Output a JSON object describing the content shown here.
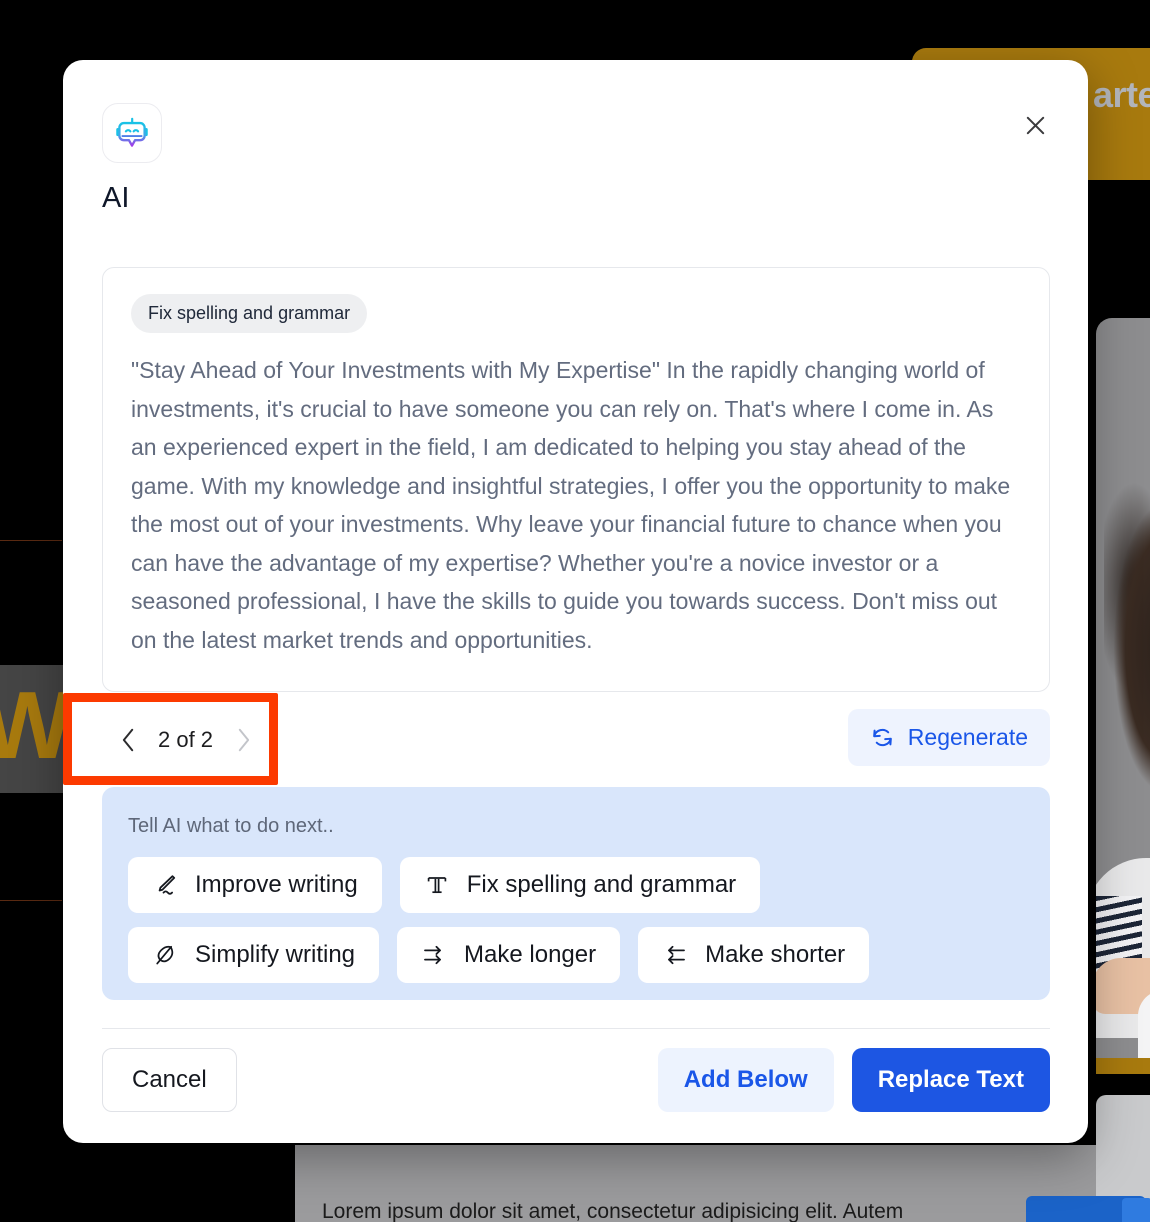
{
  "background": {
    "gold_panel_text": "arted",
    "tile_letter": "W",
    "bottom_paragraph": "Lorem ipsum dolor sit amet, consectetur adipisicing elit. Autem"
  },
  "modal": {
    "icon_name": "ai-robot-icon",
    "title": "AI",
    "close_label": "Close",
    "result": {
      "chip_label": "Fix spelling and grammar",
      "body": "\"Stay Ahead of Your Investments with My Expertise\" In the rapidly changing world of investments, it's crucial to have someone you can rely on. That's where I come in. As an experienced expert in the field, I am dedicated to helping you stay ahead of the game. With my knowledge and insightful strategies, I offer you the opportunity to make the most out of your investments. Why leave your financial future to chance when you can have the advantage of my expertise? Whether you're a novice investor or a seasoned professional, I have the skills to guide you towards success. Don't miss out on the latest market trends and opportunities."
    },
    "pager": {
      "prev_icon": "chevron-left-icon",
      "next_icon": "chevron-right-icon",
      "label": "2 of 2",
      "current": 2,
      "total": 2
    },
    "regenerate": {
      "icon": "refresh-icon",
      "label": "Regenerate"
    },
    "suggestions": {
      "hint": "Tell AI what to do next..",
      "rows": [
        [
          {
            "icon": "pencil-edit-icon",
            "glyph": "✎",
            "label": "Improve writing"
          },
          {
            "icon": "double-struck-t-icon",
            "glyph": "𝕋",
            "label": "Fix spelling and grammar"
          }
        ],
        [
          {
            "icon": "feather-quill-icon",
            "glyph": "✒",
            "label": "Simplify writing"
          },
          {
            "icon": "arrows-expand-right-icon",
            "glyph": "⇉",
            "label": "Make longer"
          },
          {
            "icon": "arrows-contract-left-icon",
            "glyph": "⇇",
            "label": "Make shorter"
          }
        ]
      ]
    },
    "footer": {
      "cancel_label": "Cancel",
      "add_below_label": "Add Below",
      "replace_label": "Replace Text"
    }
  },
  "annotation": {
    "type": "highlight-box",
    "color": "#FC3A00",
    "targets": "pagination-control"
  },
  "colors": {
    "accent_blue": "#1D56E3",
    "accent_blue_text": "#1A56E8",
    "panel_blue": "#D9E6FB",
    "body_text": "#636C7F",
    "chip_gray": "#EEEFF1",
    "annotation_red": "#FC3A00",
    "gold": "#A87A0E"
  }
}
